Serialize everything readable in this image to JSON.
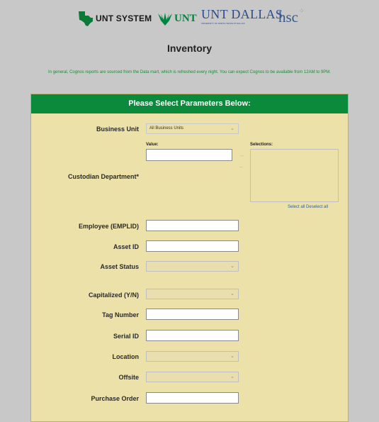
{
  "logos": {
    "unt_system": "UNT SYSTEM",
    "unt": "UNT",
    "unt_dallas": "UNT DALLAS",
    "unt_dallas_sub": "UNIVERSITY OF NORTH TEXAS AT DALLAS",
    "hsc": "hsc"
  },
  "page": {
    "title": "Inventory",
    "notice": "In general, Cognos reports are sourced from the Data mart, which is refreshed every night. You can expect Cognos to be available from 12AM to 9PM."
  },
  "panel": {
    "header": "Please Select Parameters Below:"
  },
  "form": {
    "business_unit_label": "Business Unit",
    "business_unit_value": "All Business Units",
    "value_label": "Value:",
    "selections_label": "Selections:",
    "custodian_label": "Custodian Department*",
    "select_all": "Select all",
    "deselect_all": "Deselect all",
    "employee_label": "Employee (EMPLID)",
    "asset_id_label": "Asset ID",
    "asset_status_label": "Asset Status",
    "capitalized_label": "Capitalized (Y/N)",
    "tag_number_label": "Tag Number",
    "serial_id_label": "Serial ID",
    "location_label": "Location",
    "offsite_label": "Offsite",
    "purchase_order_label": "Purchase Order"
  },
  "colors": {
    "panel_header": "#0b8a3b",
    "panel_bg": "#ece1a8",
    "notice_text": "#1f8a3b",
    "link": "#2b5faa",
    "page_bg": "#c8c8c8"
  },
  "icons": {
    "dropdown": "chevron-down-icon",
    "move_right": "arrow-right-icon",
    "move_left": "arrow-left-icon"
  }
}
